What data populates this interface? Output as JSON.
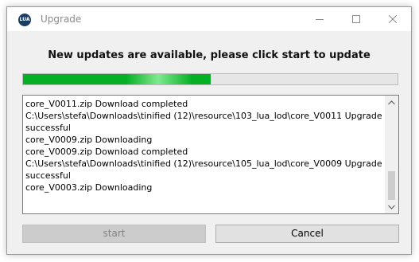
{
  "window": {
    "title": "Upgrade",
    "app_icon_text": "LUA"
  },
  "heading": "New updates are available, please click start to update",
  "progress": {
    "fraction": 0.5,
    "color": "#06b025"
  },
  "log": {
    "lines": [
      "core_V0011.zip Download completed",
      "C:\\Users\\stefa\\Downloads\\tinified (12)\\resource\\103_lua_lod\\core_V0011 Upgrade successful",
      "core_V0009.zip Downloading",
      "core_V0009.zip Download completed",
      "C:\\Users\\stefa\\Downloads\\tinified (12)\\resource\\105_lua_lod\\core_V0009 Upgrade successful",
      "core_V0003.zip Downloading"
    ]
  },
  "buttons": {
    "start_label": "start",
    "cancel_label": "Cancel"
  },
  "icons": {
    "minimize": "minimize-icon",
    "maximize": "maximize-icon",
    "close": "close-icon",
    "scroll_up": "chevron-up-icon",
    "scroll_down": "chevron-down-icon"
  }
}
